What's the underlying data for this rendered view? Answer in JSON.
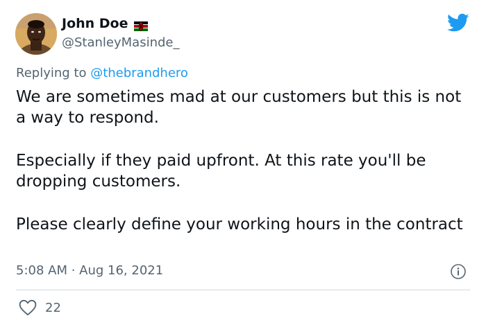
{
  "author": {
    "display_name": "John Doe",
    "handle": "@StanleyMasinde_",
    "flag_icon": "kenya-flag-icon",
    "avatar_icon": "avatar-photo"
  },
  "reply": {
    "prefix": "Replying to ",
    "mention": "@thebrandhero"
  },
  "tweet": {
    "paragraphs": [
      "We are sometimes mad at our customers but this is not a way to respond.",
      "Especially if they paid upfront. At this rate you'll be dropping customers.",
      "Please clearly define your working hours in the contract"
    ]
  },
  "meta": {
    "timestamp": "5:08 AM · Aug 16, 2021"
  },
  "actions": {
    "like_count": "22",
    "like_icon": "heart-icon",
    "info_icon": "info-icon"
  },
  "brand": {
    "logo_icon": "twitter-bird-icon",
    "accent_color": "#1d9bf0"
  }
}
